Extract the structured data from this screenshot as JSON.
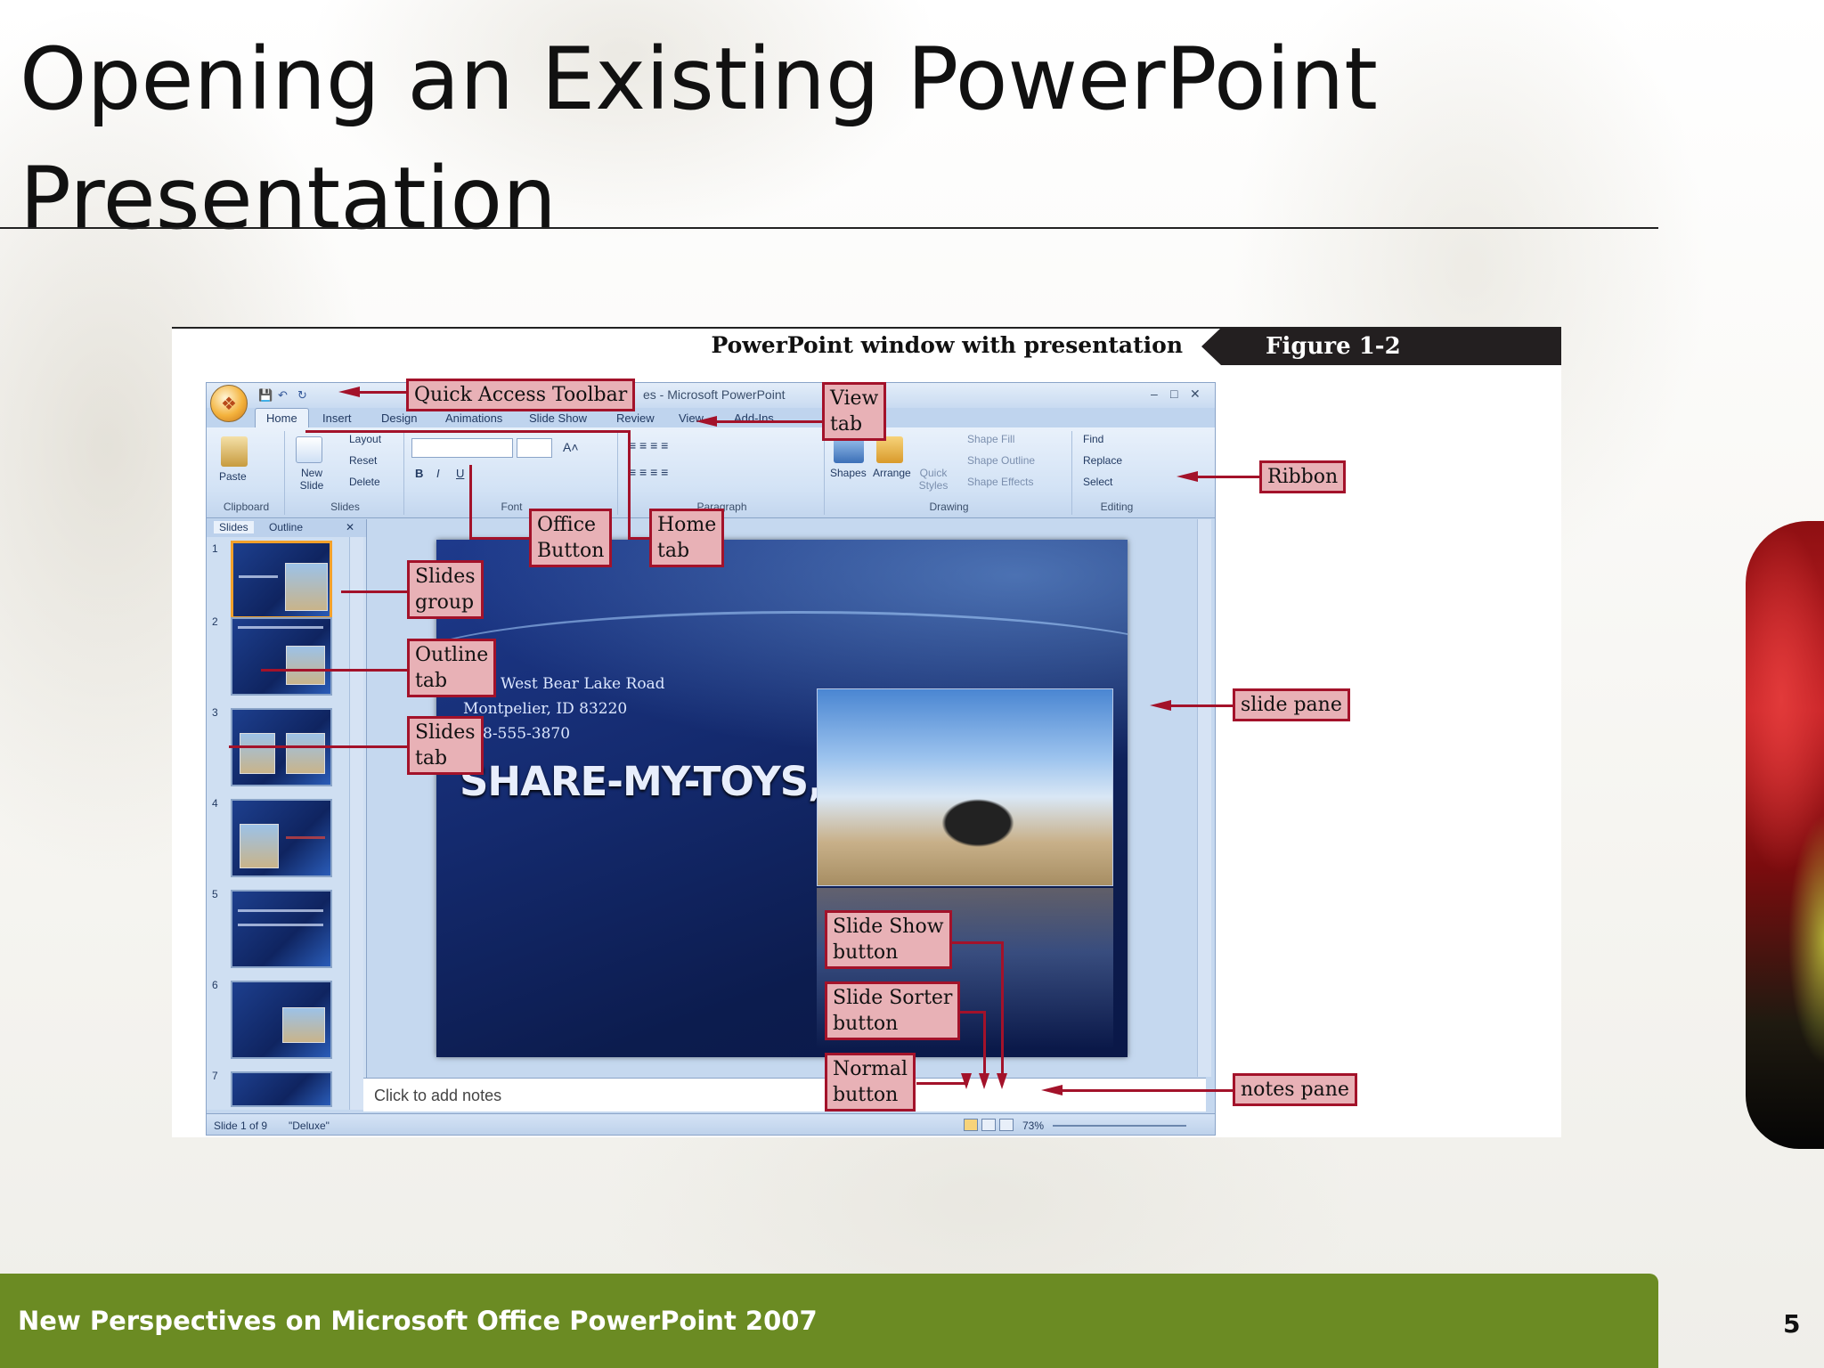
{
  "slide": {
    "title": "Opening an Existing PowerPoint Presentation",
    "footer": "New Perspectives on Microsoft Office PowerPoint 2007",
    "page_number": "5"
  },
  "figure": {
    "caption": "PowerPoint window with presentation",
    "label": "Figure  1-2"
  },
  "powerpoint": {
    "window_title": "es - Microsoft PowerPoint",
    "tabs": [
      "Home",
      "Insert",
      "Design",
      "Animations",
      "Slide Show",
      "Review",
      "View",
      "Add-Ins"
    ],
    "ribbon": {
      "clipboard": {
        "paste": "Paste",
        "label": "Clipboard"
      },
      "slides": {
        "new_slide": "New Slide",
        "layout": "Layout",
        "reset": "Reset",
        "delete": "Delete",
        "label": "Slides"
      },
      "font": {
        "label": "Font"
      },
      "paragraph": {
        "label": "Paragraph"
      },
      "drawing": {
        "shapes": "Shapes",
        "arrange": "Arrange",
        "quick_styles": "Quick Styles",
        "shape_fill": "Shape Fill",
        "shape_outline": "Shape Outline",
        "shape_effects": "Shape Effects",
        "label": "Drawing"
      },
      "editing": {
        "find": "Find",
        "replace": "Replace",
        "select": "Select",
        "label": "Editing"
      }
    },
    "pane_tabs": {
      "slides": "Slides",
      "outline": "Outline"
    },
    "thumbnail_numbers": [
      "1",
      "2",
      "3",
      "4",
      "5",
      "6",
      "7"
    ],
    "slide_content": {
      "address_line1": "West Bear Lake Road",
      "address_line2": "Montpelier, ID 83220",
      "phone": "8-555-3870",
      "company": "SHARE-MY-TOYS, INC."
    },
    "notes_placeholder": "Click to add notes",
    "status": {
      "slide_info": "Slide 1 of 9",
      "theme": "\"Deluxe\"",
      "zoom": "73%"
    }
  },
  "callouts": {
    "quick_access_toolbar": "Quick Access Toolbar",
    "view_tab": [
      "View",
      "tab"
    ],
    "ribbon": "Ribbon",
    "office_button": [
      "Office",
      "Button"
    ],
    "home_tab": [
      "Home",
      "tab"
    ],
    "slides_group": [
      "Slides",
      "group"
    ],
    "outline_tab": [
      "Outline",
      "tab"
    ],
    "slides_tab": [
      "Slides",
      "tab"
    ],
    "slide_pane": "slide pane",
    "slide_show_button": [
      "Slide Show",
      "button"
    ],
    "slide_sorter_button": [
      "Slide Sorter",
      "button"
    ],
    "normal_button": [
      "Normal",
      "button"
    ],
    "notes_pane": "notes pane"
  },
  "colors": {
    "footer_green": "#6b8b23",
    "callout_fill": "#e8b1b6",
    "callout_border": "#a3122a"
  }
}
